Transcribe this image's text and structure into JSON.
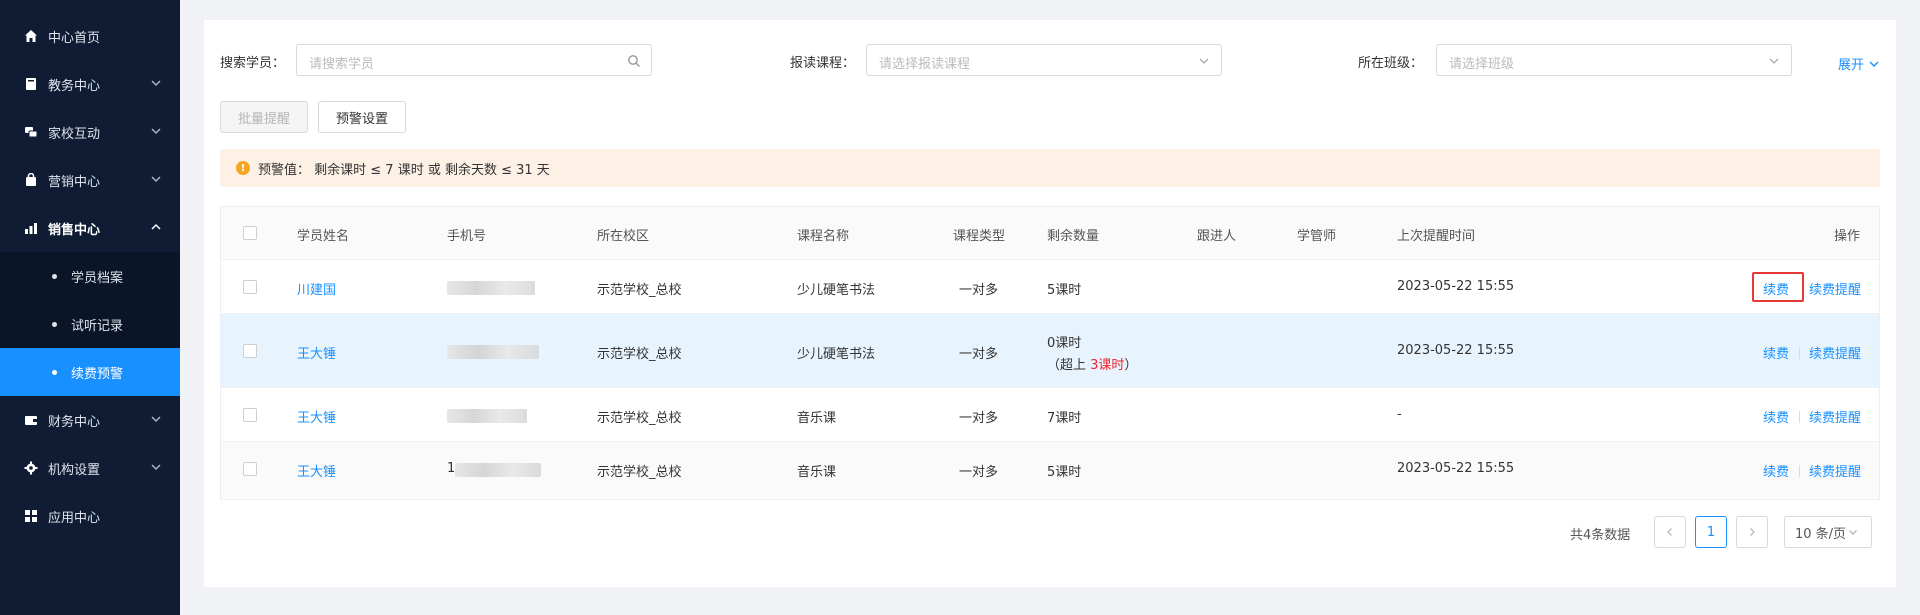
{
  "sidebar": {
    "items": [
      {
        "label": "中心首页"
      },
      {
        "label": "教务中心"
      },
      {
        "label": "家校互动"
      },
      {
        "label": "营销中心"
      },
      {
        "label": "销售中心"
      },
      {
        "label": "财务中心"
      },
      {
        "label": "机构设置"
      },
      {
        "label": "应用中心"
      }
    ],
    "subitems": [
      {
        "label": "学员档案"
      },
      {
        "label": "试听记录"
      },
      {
        "label": "续费预警"
      }
    ]
  },
  "filters": {
    "student_label": "搜索学员：",
    "student_placeholder": "请搜索学员",
    "course_label": "报读课程：",
    "course_placeholder": "请选择报读课程",
    "class_label": "所在班级：",
    "class_placeholder": "请选择班级",
    "expand_label": "展开"
  },
  "toolbar": {
    "batch_remind": "批量提醒",
    "warning_settings": "预警设置"
  },
  "alert": {
    "text": "预警值：  剩余课时 ≤ 7 课时 或 剩余天数 ≤ 31 天"
  },
  "table": {
    "headers": {
      "name": "学员姓名",
      "phone": "手机号",
      "campus": "所在校区",
      "course": "课程名称",
      "type": "课程类型",
      "remaining": "剩余数量",
      "follower": "跟进人",
      "manager": "学管师",
      "last_remind": "上次提醒时间",
      "ops": "操作"
    },
    "rows": [
      {
        "name": "川建国",
        "phone": "",
        "campus": "示范学校_总校",
        "course": "少儿硬笔书法",
        "type": "一对多",
        "remaining": "5课时",
        "last": "2023-05-22 15:55"
      },
      {
        "name": "王大锤",
        "phone": "",
        "campus": "示范学校_总校",
        "course": "少儿硬笔书法",
        "type": "一对多",
        "remaining": "0课时",
        "over_prefix": "（超上 ",
        "over_value": "3课时",
        "over_suffix": "）",
        "last": "2023-05-22 15:55"
      },
      {
        "name": "王大锤",
        "phone": "",
        "campus": "示范学校_总校",
        "course": "音乐课",
        "type": "一对多",
        "remaining": "7课时",
        "last": "-"
      },
      {
        "name": "王大锤",
        "phone": "1",
        "campus": "示范学校_总校",
        "course": "音乐课",
        "type": "一对多",
        "remaining": "5课时",
        "last": "2023-05-22 15:55"
      }
    ],
    "renew": "续费",
    "renew_remind": "续费提醒"
  },
  "pagination": {
    "total": "共4条数据",
    "current": "1",
    "page_size": "10 条/页"
  },
  "colors": {
    "sidebar_bg": "#0f1c33",
    "active_blue": "#1890ff",
    "warning_orange": "#f5a623",
    "alert_bg": "#fdf1e6",
    "highlight_row": "#e8f4fd",
    "red": "#f5222d"
  }
}
